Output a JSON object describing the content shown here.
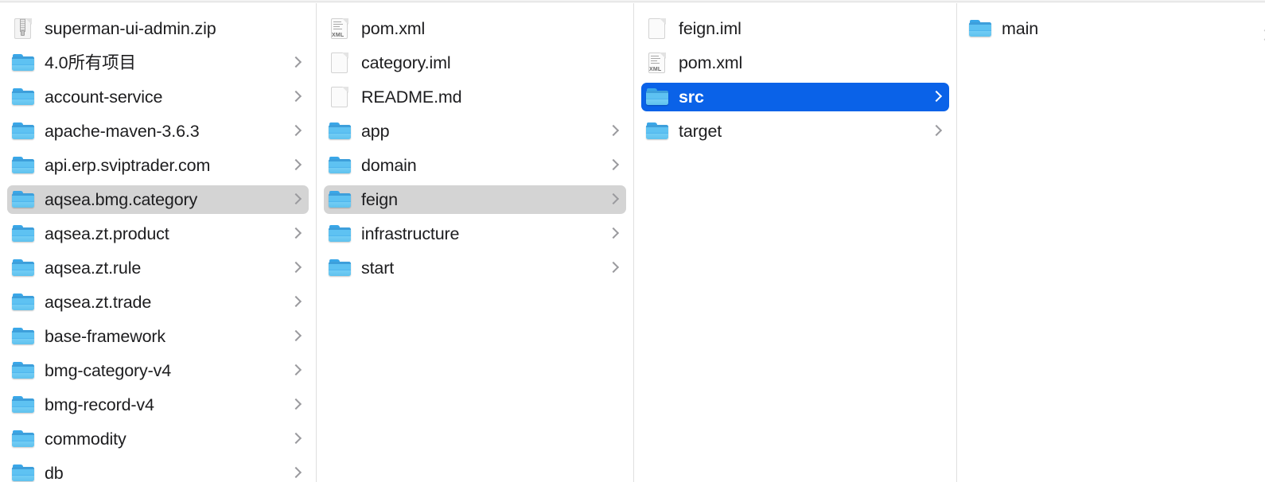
{
  "window": {
    "title": "Finder Column View",
    "view_mode": "column"
  },
  "theme": {
    "background": "#ffffff",
    "accent_selection": "#0a62e8",
    "inactive_selection": "#d4d4d4",
    "text": "#1d1d1f",
    "selected_text": "#ffffff",
    "divider": "#dfdfdf",
    "chevron": "#9a9a9e"
  },
  "columns": [
    {
      "name": "column-1",
      "items": [
        {
          "label": "superman-ui-admin.zip",
          "icon": "zip-file-icon",
          "kind": "file",
          "chevron": false,
          "selected": "none"
        },
        {
          "label": "4.0所有项目",
          "icon": "folder-icon",
          "kind": "folder",
          "chevron": true,
          "selected": "none"
        },
        {
          "label": "account-service",
          "icon": "folder-icon",
          "kind": "folder",
          "chevron": true,
          "selected": "none"
        },
        {
          "label": "apache-maven-3.6.3",
          "icon": "folder-icon",
          "kind": "folder",
          "chevron": true,
          "selected": "none"
        },
        {
          "label": "api.erp.sviptrader.com",
          "icon": "folder-icon",
          "kind": "folder",
          "chevron": true,
          "selected": "none"
        },
        {
          "label": "aqsea.bmg.category",
          "icon": "folder-icon",
          "kind": "folder",
          "chevron": true,
          "selected": "inactive"
        },
        {
          "label": "aqsea.zt.product",
          "icon": "folder-icon",
          "kind": "folder",
          "chevron": true,
          "selected": "none"
        },
        {
          "label": "aqsea.zt.rule",
          "icon": "folder-icon",
          "kind": "folder",
          "chevron": true,
          "selected": "none"
        },
        {
          "label": "aqsea.zt.trade",
          "icon": "folder-icon",
          "kind": "folder",
          "chevron": true,
          "selected": "none"
        },
        {
          "label": "base-framework",
          "icon": "folder-icon",
          "kind": "folder",
          "chevron": true,
          "selected": "none"
        },
        {
          "label": "bmg-category-v4",
          "icon": "folder-icon",
          "kind": "folder",
          "chevron": true,
          "selected": "none"
        },
        {
          "label": "bmg-record-v4",
          "icon": "folder-icon",
          "kind": "folder",
          "chevron": true,
          "selected": "none"
        },
        {
          "label": "commodity",
          "icon": "folder-icon",
          "kind": "folder",
          "chevron": true,
          "selected": "none"
        },
        {
          "label": "db",
          "icon": "folder-icon",
          "kind": "folder",
          "chevron": true,
          "selected": "none"
        }
      ]
    },
    {
      "name": "column-2",
      "items": [
        {
          "label": "pom.xml",
          "icon": "xml-file-icon",
          "kind": "file",
          "chevron": false,
          "selected": "none"
        },
        {
          "label": "category.iml",
          "icon": "plain-file-icon",
          "kind": "file",
          "chevron": false,
          "selected": "none"
        },
        {
          "label": "README.md",
          "icon": "plain-file-icon",
          "kind": "file",
          "chevron": false,
          "selected": "none"
        },
        {
          "label": "app",
          "icon": "folder-icon",
          "kind": "folder",
          "chevron": true,
          "selected": "none"
        },
        {
          "label": "domain",
          "icon": "folder-icon",
          "kind": "folder",
          "chevron": true,
          "selected": "none"
        },
        {
          "label": "feign",
          "icon": "folder-icon",
          "kind": "folder",
          "chevron": true,
          "selected": "inactive"
        },
        {
          "label": "infrastructure",
          "icon": "folder-icon",
          "kind": "folder",
          "chevron": true,
          "selected": "none"
        },
        {
          "label": "start",
          "icon": "folder-icon",
          "kind": "folder",
          "chevron": true,
          "selected": "none"
        }
      ]
    },
    {
      "name": "column-3",
      "items": [
        {
          "label": "feign.iml",
          "icon": "plain-file-icon",
          "kind": "file",
          "chevron": false,
          "selected": "none"
        },
        {
          "label": "pom.xml",
          "icon": "xml-file-icon",
          "kind": "file",
          "chevron": false,
          "selected": "none"
        },
        {
          "label": "src",
          "icon": "folder-icon",
          "kind": "folder",
          "chevron": true,
          "selected": "active"
        },
        {
          "label": "target",
          "icon": "folder-icon",
          "kind": "folder",
          "chevron": true,
          "selected": "none"
        }
      ]
    },
    {
      "name": "column-4",
      "items": [
        {
          "label": "main",
          "icon": "folder-icon",
          "kind": "folder",
          "chevron": false,
          "selected": "none"
        }
      ]
    }
  ]
}
